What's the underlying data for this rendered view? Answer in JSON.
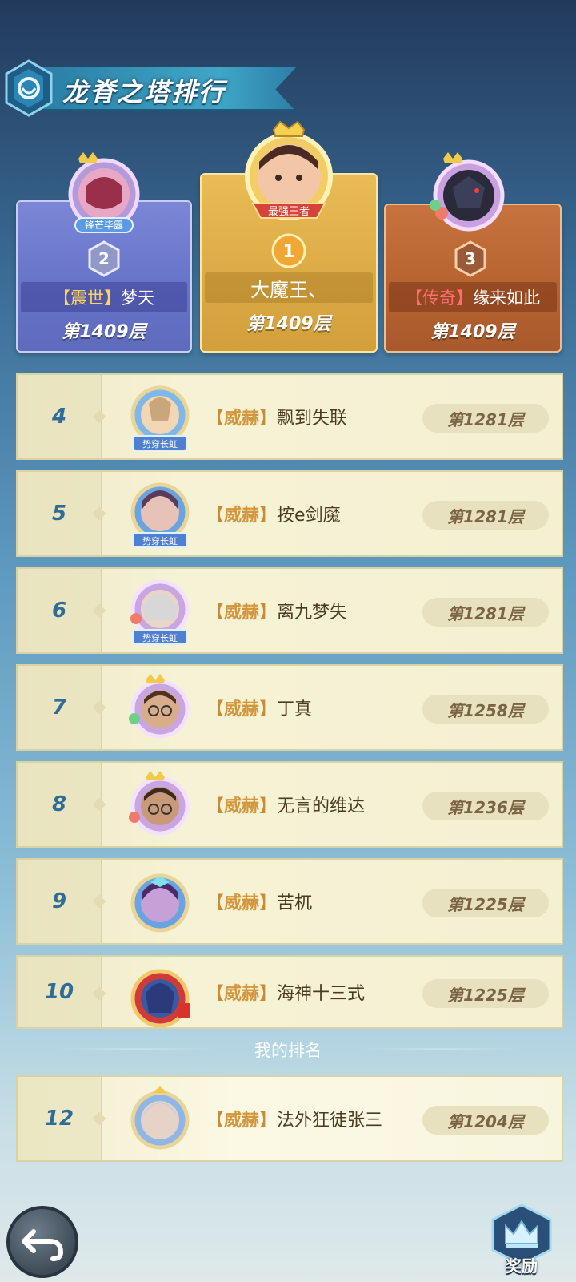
{
  "header": {
    "title": "龙脊之塔排行"
  },
  "podium": [
    {
      "rank": "2",
      "badge": "锋芒毕露",
      "tag": "震世",
      "name": "梦天",
      "floor": "第1409层",
      "card_color": "#6f7bcf"
    },
    {
      "rank": "1",
      "badge": "最强王者",
      "tag": "",
      "name": "大魔王、",
      "floor": "第1409层",
      "card_color": "#e2b24b"
    },
    {
      "rank": "3",
      "badge": "",
      "tag": "传奇",
      "name": "缘来如此",
      "floor": "第1409层",
      "card_color": "#b9663a"
    }
  ],
  "rankings": [
    {
      "rank": "4",
      "tag": "威赫",
      "name": "飘到失联",
      "floor": "第1281层",
      "frame_label": "势穿长虹"
    },
    {
      "rank": "5",
      "tag": "威赫",
      "name": "按e剑魔",
      "floor": "第1281层",
      "frame_label": "势穿长虹"
    },
    {
      "rank": "6",
      "tag": "威赫",
      "name": "离九梦失",
      "floor": "第1281层",
      "frame_label": "势穿长虹"
    },
    {
      "rank": "7",
      "tag": "威赫",
      "name": "丁真",
      "floor": "第1258层",
      "frame_label": ""
    },
    {
      "rank": "8",
      "tag": "威赫",
      "name": "无言的维达",
      "floor": "第1236层",
      "frame_label": ""
    },
    {
      "rank": "9",
      "tag": "威赫",
      "name": "苦杌",
      "floor": "第1225层",
      "frame_label": ""
    },
    {
      "rank": "10",
      "tag": "威赫",
      "name": "海神十三式",
      "floor": "第1225层",
      "frame_label": ""
    }
  ],
  "my_rank": {
    "label": "我的排名",
    "rank": "12",
    "tag": "威赫",
    "name": "法外狂徒张三",
    "floor": "第1204层"
  },
  "buttons": {
    "back_icon": "back-arrow-icon",
    "reward_label": "奖励"
  },
  "colors": {
    "rank_text": "#2f6c96",
    "tag_text": "#d4963c",
    "row_bg": "#f4f0d2"
  }
}
